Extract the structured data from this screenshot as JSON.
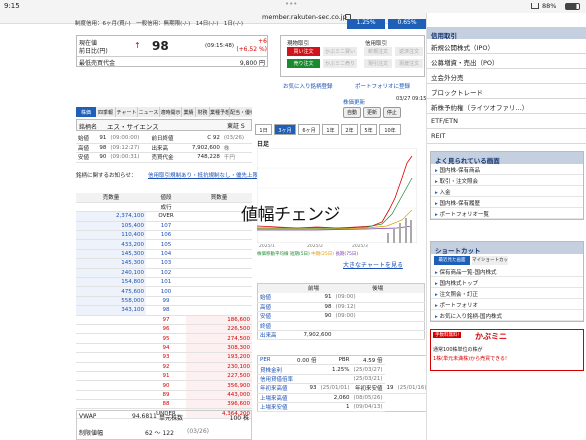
{
  "status": {
    "time": "9:15",
    "battery": "88%"
  },
  "url": "member.rakuten-sec.co.jp",
  "header": {
    "margin_info": "制度信用：6ヶ月(買/-)　一般信用：無期限(-/-)　14日(-/-)　1日(-/-)",
    "pct1": "1.25%",
    "pct2": "0.65%"
  },
  "quote": {
    "label_now": "現在値",
    "label_prev": "前日比(円)",
    "label_min": "最低売買代金",
    "price": "98",
    "time": "(09:15:48)",
    "change": "+6",
    "change_pct": "(+6.52 %)",
    "min_amount": "9,800 円",
    "arrow": "↑"
  },
  "orders": {
    "spot_title": "現物取引",
    "margin_title": "信用取引",
    "buy_spot": "買い注文",
    "sell_spot": "売り注文",
    "buy_closed": "かぶミニ買い",
    "sell_closed": "かぶミニ売り",
    "margin_new": "新規注文",
    "margin_close": "返済注文",
    "margin_recv": "現引注文",
    "margin_deliv": "現渡注文",
    "favorite": "お気に入り銘柄登録",
    "portfolio": "ポートフォリオに登録"
  },
  "tabs": [
    "株価",
    "四季報",
    "チャート",
    "ニュース",
    "適時開示",
    "業績",
    "財務",
    "業種予想",
    "配当・優待"
  ],
  "stock": {
    "name_label": "銘柄名",
    "name": "エス・サイエンス",
    "market": "東証 S",
    "rows": [
      [
        "始値",
        "91",
        "(09:00:00)",
        "前日終値",
        "C 92",
        "(03/26)"
      ],
      [
        "高値",
        "98",
        "(09:12:27)",
        "出来高",
        "7,902,600",
        "株"
      ],
      [
        "安値",
        "90",
        "(09:00:31)",
        "売買代金",
        "748,228",
        "千円"
      ]
    ]
  },
  "notice": "銘柄に関するお知らせ：",
  "notice_links": "信用取引規制あり・抵抗規制なし・優先上限",
  "orderbook": {
    "headers": [
      "売数量",
      "値段",
      "買数量"
    ],
    "rows": [
      [
        "",
        "成行",
        ""
      ],
      [
        "2,374,100",
        "OVER",
        ""
      ],
      [
        "105,400",
        "107",
        ""
      ],
      [
        "110,400",
        "106",
        ""
      ],
      [
        "433,200",
        "105",
        ""
      ],
      [
        "145,300",
        "104",
        ""
      ],
      [
        "145,300",
        "103",
        ""
      ],
      [
        "240,100",
        "102",
        ""
      ],
      [
        "154,800",
        "101",
        ""
      ],
      [
        "475,600",
        "100",
        ""
      ],
      [
        "558,000",
        "99",
        ""
      ],
      [
        "343,100",
        "98",
        ""
      ],
      [
        "",
        "97",
        "186,600"
      ],
      [
        "",
        "96",
        "226,500"
      ],
      [
        "",
        "95",
        "274,500"
      ],
      [
        "",
        "94",
        "308,300"
      ],
      [
        "",
        "93",
        "193,200"
      ],
      [
        "",
        "92",
        "230,100"
      ],
      [
        "",
        "91",
        "227,500"
      ],
      [
        "",
        "90",
        "356,900"
      ],
      [
        "",
        "89",
        "443,000"
      ],
      [
        "",
        "88",
        "396,600"
      ],
      [
        "",
        "UNDER",
        "4,364,200"
      ]
    ]
  },
  "vwap": {
    "label": "VWAP",
    "value": "94.6811",
    "unit_label": "単元株数",
    "unit": "100 株"
  },
  "limit": {
    "label": "制限値幅",
    "value": "62 ～ 122",
    "date": "(03/26)"
  },
  "chart": {
    "info_label": "株価更新",
    "timestamp": "03/27 09:15",
    "auto": "自動",
    "refresh": "更新",
    "stop": "停止",
    "periods": [
      "1日",
      "3ヶ月",
      "6ヶ月",
      "1年",
      "2年",
      "5年",
      "10年"
    ],
    "active_period": "3ヶ月",
    "kind": "日足",
    "overlay_text": "値幅チェンジ",
    "big_link": "大きなチャートを見る",
    "legend": [
      "株価移動平均線",
      "短期(5日)",
      "中期(25日)",
      "長期(75日)"
    ],
    "xlabels": [
      "2025/1",
      "2025/2",
      "2025/3"
    ]
  },
  "prices_table": {
    "headers": [
      "",
      "前場",
      "",
      "後場",
      ""
    ],
    "rows": [
      [
        "始値",
        "91",
        "(09:00)",
        "",
        ""
      ],
      [
        "高値",
        "98",
        "(09:12)",
        "",
        ""
      ],
      [
        "安値",
        "90",
        "(09:00)",
        "",
        ""
      ],
      [
        "終値",
        "",
        "",
        "",
        ""
      ],
      [
        "出来高",
        "7,902,600",
        "",
        "",
        ""
      ]
    ]
  },
  "fund": {
    "rows": [
      [
        "PER",
        "0.00 倍",
        "PBR",
        "4.59 倍"
      ],
      [
        "貸株金利",
        "",
        "1.25%",
        "(25/03/27)"
      ],
      [
        "信用貸借倍率",
        "",
        "",
        "(25/03/21)"
      ],
      [
        "年初来高値",
        "93",
        "(25/01/01)",
        "年初来安値",
        "19",
        "(25/01/16)"
      ],
      [
        "上場来高値",
        "",
        "2,060",
        "(08/05/26)"
      ],
      [
        "上場来安値",
        "",
        "1",
        "(09/04/13)"
      ]
    ]
  },
  "sidebar": {
    "menu_title": "信用取引",
    "items": [
      "新規公開株式（IPO）",
      "公募増資・売出（PO）",
      "立会外分売",
      "ブロックトレード",
      "新株予約権（ライツオファリ...）",
      "ETF/ETN",
      "REIT"
    ],
    "popular_title": "よく見られている画面",
    "popular": [
      "国内株-保有商品",
      "取引・注文照会",
      "入金",
      "国内株-保有履歴",
      "ポートフォリオ一覧"
    ],
    "shortcut_title": "ショートカット",
    "shortcut_tabs": [
      "最近見た画面",
      "マイショートカット"
    ],
    "shortcuts": [
      "保有商品一覧-国内株式",
      "国内株式トップ",
      "注文照会・訂正",
      "ポートフォリオ",
      "お気に入り銘柄-国内株式"
    ],
    "promo_tag": "手数料無料!",
    "promo_brand": "かぶミニ",
    "promo_lines": [
      "通常100株単位の株が",
      "1株(単元未満株)から売買できる!"
    ],
    "colors": {
      "accent": "#3b5998",
      "buy": "#d0121a",
      "sell": "#1a8a2e"
    }
  }
}
